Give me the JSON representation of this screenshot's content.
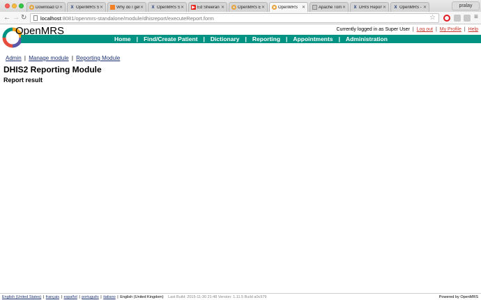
{
  "browser": {
    "tabs": [
      {
        "label": "Download Op",
        "icon": "openmrs-icon",
        "active": false
      },
      {
        "label": "OpenMRS Sta",
        "icon": "x-icon",
        "active": false
      },
      {
        "label": "Why do I get a",
        "icon": "stackoverflow-icon",
        "active": false
      },
      {
        "label": "OpenMRS Sta",
        "icon": "x-icon",
        "active": false
      },
      {
        "label": "Ed Sheeran",
        "icon": "youtube-icon",
        "active": false
      },
      {
        "label": "OpenMRS Ele",
        "icon": "openmrs-icon",
        "active": false
      },
      {
        "label": "OpenMRS",
        "icon": "openmrs-icon",
        "active": true
      },
      {
        "label": "Apache Tomca",
        "icon": "tomcat-icon",
        "active": false
      },
      {
        "label": "DHIS Report",
        "icon": "x-icon",
        "active": false
      },
      {
        "label": "OpenMRS - D",
        "icon": "x-icon",
        "active": false
      }
    ],
    "user": "pralay",
    "url_host": "localhost",
    "url_path": ":8081/openmrs-standalone/module/dhisreport/executeReport.form"
  },
  "header": {
    "brand": "OpenMRS",
    "logged_in_text": "Currently logged in as Super User",
    "logout": "Log out",
    "my_profile": "My Profile",
    "help": "Help",
    "sep": "|"
  },
  "nav": {
    "items": [
      "Home",
      "Find/Create Patient",
      "Dictionary",
      "Reporting",
      "Appointments",
      "Administration"
    ],
    "sep": "|"
  },
  "breadcrumb": {
    "admin": "Admin",
    "manage_module": "Manage module",
    "reporting_module": "Reporting Module",
    "sep": "|"
  },
  "main": {
    "title": "DHIS2 Reporting Module",
    "subtitle": "Report result"
  },
  "footer": {
    "langs": [
      "English (United States)",
      "français",
      "español",
      "português",
      "italiano"
    ],
    "current_lang": "English (United Kingdom)",
    "sep": "|",
    "build": "Last Build: 2015-11-30 21:48   Version: 1.11.5 Build a0c979",
    "powered": "Powered by OpenMRS"
  },
  "colors": {
    "nav_bg": "#009384",
    "link_red": "#c8362a",
    "link_blue": "#1a2f6e"
  }
}
